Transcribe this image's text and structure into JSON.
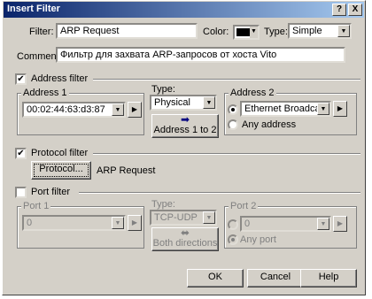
{
  "dialog": {
    "title": "Insert Filter",
    "help_button": "?",
    "close_button": "X"
  },
  "filter": {
    "label": "Filter:",
    "value": "ARP Request"
  },
  "color": {
    "label": "Color:",
    "value": "#000000"
  },
  "type": {
    "label": "Type:",
    "value": "Simple"
  },
  "comment": {
    "label": "Comment:",
    "value": "Фильтр для захвата ARP-запросов от хоста Vito"
  },
  "address_filter": {
    "label": "Address filter",
    "checked": true,
    "address1": {
      "label": "Address 1",
      "value": "00:02:44:63:d3:87",
      "button": "▶"
    },
    "type": {
      "label": "Type:",
      "value": "Physical"
    },
    "direction_button": "Address 1 to 2",
    "address2": {
      "label": "Address 2",
      "option1": "Ethernet Broadcast",
      "option2": "Any address",
      "button": "▶"
    }
  },
  "protocol_filter": {
    "label": "Protocol filter",
    "checked": true,
    "button": "Protocol...",
    "value": "ARP Request"
  },
  "port_filter": {
    "label": "Port filter",
    "checked": false,
    "port1": {
      "label": "Port 1",
      "value": "0",
      "button": "▶"
    },
    "type": {
      "label": "Type:",
      "value": "TCP-UDP"
    },
    "direction_button": "Both directions",
    "port2": {
      "label": "Port 2",
      "value": "0",
      "any": "Any port",
      "button": "▶"
    }
  },
  "buttons": {
    "ok": "OK",
    "cancel": "Cancel",
    "help": "Help"
  }
}
